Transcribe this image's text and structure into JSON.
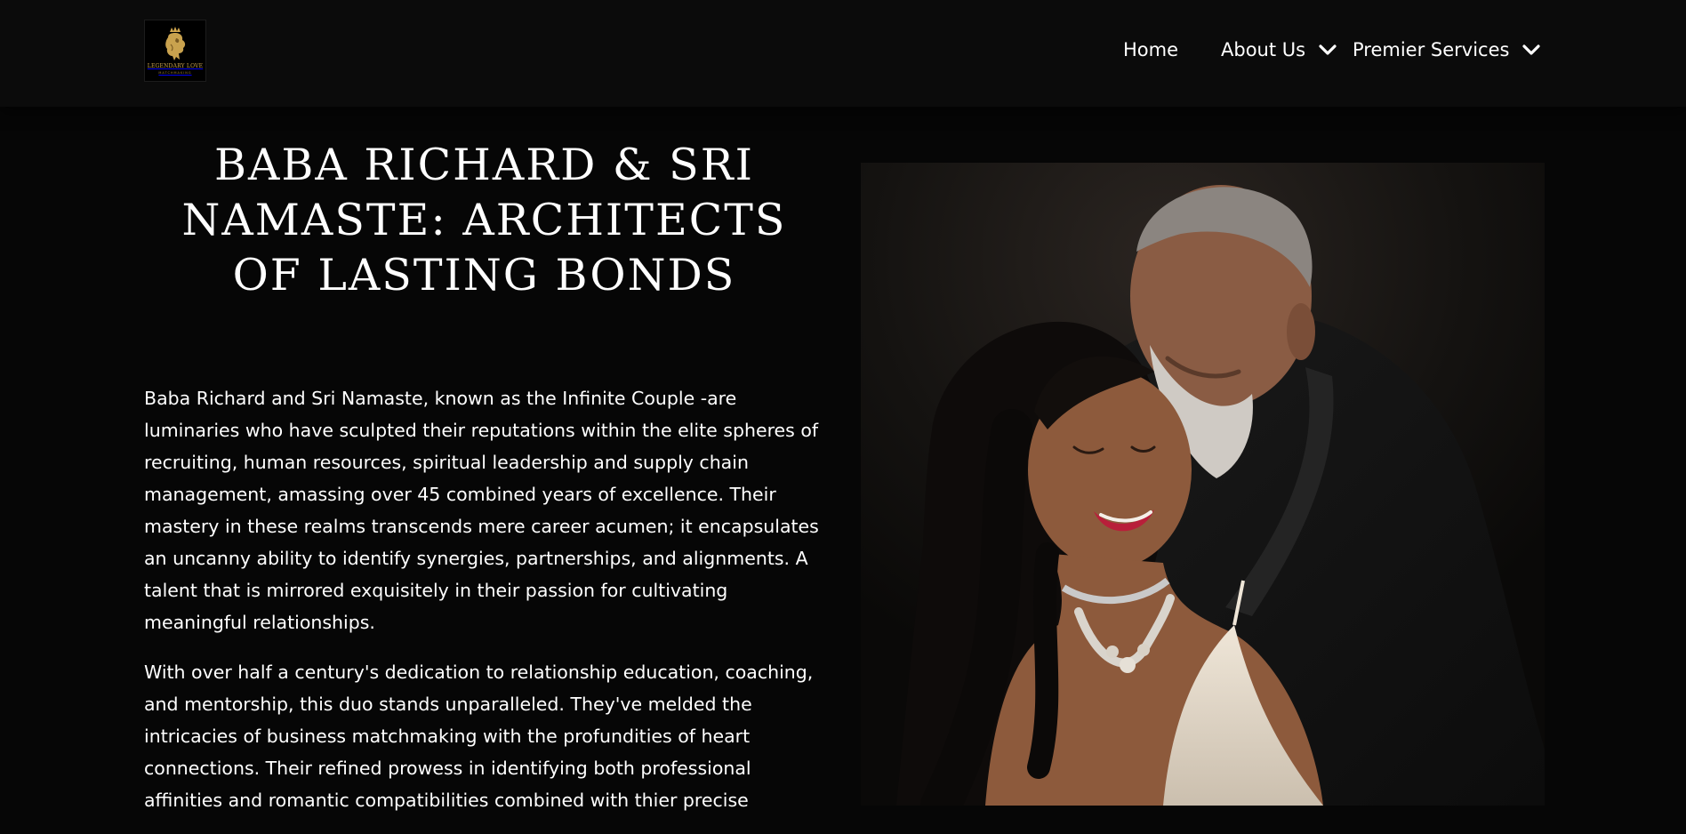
{
  "header": {
    "logo": {
      "text": "LEGENDARY LOVE",
      "subtext": "MATCHMAKING",
      "alt": "Legendary Love Matchmaking"
    },
    "nav": [
      {
        "label": "Home",
        "has_dropdown": false
      },
      {
        "label": "About Us",
        "has_dropdown": true
      },
      {
        "label": "Premier Services",
        "has_dropdown": true
      }
    ]
  },
  "hero": {
    "title": "BABA RICHARD & SRI NAMASTE: ARCHITECTS OF LASTING BONDS",
    "paragraphs": [
      "Baba Richard and Sri Namaste, known as the Infinite Couple -are luminaries who have sculpted their reputations within the elite spheres of recruiting, human resources, spiritual leadership and supply chain management, amassing over 45 combined years of excellence. Their mastery in these realms transcends mere career acumen; it encapsulates an uncanny ability to identify synergies, partnerships, and alignments. A talent that is mirrored exquisitely in their passion for cultivating meaningful relationships.",
      "With over half a century's dedication to relationship education, coaching, and mentorship, this duo stands unparalleled. They've melded the intricacies of business matchmaking with the profundities of heart connections. Their refined prowess in identifying both professional affinities and romantic compatibilities combined with thier precise"
    ]
  },
  "photo": {
    "description": "Portrait of Baba Richard and Sri Namaste"
  },
  "colors": {
    "background": "#060606",
    "header_bg": "#0b0b0b",
    "text": "#ffffff",
    "logo_gold": "#c9a24e"
  }
}
